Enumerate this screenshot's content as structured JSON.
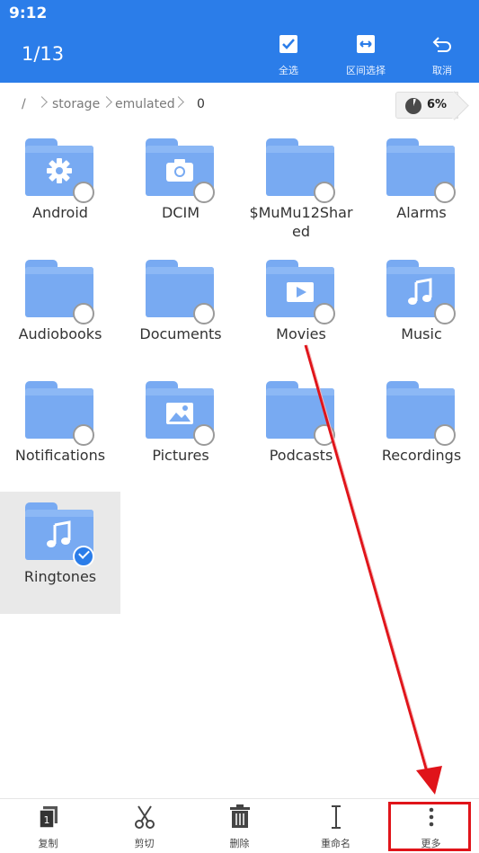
{
  "status_bar": {
    "time": "9:12"
  },
  "top_bar": {
    "counter": "1/13",
    "actions": [
      {
        "label": "全选",
        "icon": "select-all-icon"
      },
      {
        "label": "区间选择",
        "icon": "range-select-icon"
      },
      {
        "label": "取消",
        "icon": "undo-icon"
      }
    ]
  },
  "path": {
    "root": "/",
    "segments": [
      "storage",
      "emulated",
      "0"
    ],
    "storage_percent": "6%",
    "storage_used_fraction": 0.06
  },
  "folders": [
    {
      "name": "Android",
      "icon": "gear-icon",
      "selected": false
    },
    {
      "name": "DCIM",
      "icon": "camera-icon",
      "selected": false
    },
    {
      "name": "$MuMu12Shar\ned",
      "icon": "none",
      "selected": false
    },
    {
      "name": "Alarms",
      "icon": "none",
      "selected": false
    },
    {
      "name": "Audiobooks",
      "icon": "none",
      "selected": false
    },
    {
      "name": "Documents",
      "icon": "none",
      "selected": false
    },
    {
      "name": "Movies",
      "icon": "play-icon",
      "selected": false
    },
    {
      "name": "Music",
      "icon": "music-note-icon",
      "selected": false
    },
    {
      "name": "Notifications",
      "icon": "none",
      "selected": false
    },
    {
      "name": "Pictures",
      "icon": "image-icon",
      "selected": false
    },
    {
      "name": "Podcasts",
      "icon": "none",
      "selected": false
    },
    {
      "name": "Recordings",
      "icon": "none",
      "selected": false
    },
    {
      "name": "Ringtones",
      "icon": "music-note-icon",
      "selected": true
    }
  ],
  "bottom_bar": {
    "actions": [
      {
        "label": "复制",
        "icon": "copy-icon"
      },
      {
        "label": "剪切",
        "icon": "scissors-icon"
      },
      {
        "label": "删除",
        "icon": "trash-icon"
      },
      {
        "label": "重命名",
        "icon": "text-cursor-icon"
      },
      {
        "label": "更多",
        "icon": "more-vertical-icon"
      }
    ]
  },
  "colors": {
    "accent": "#2b7de9",
    "folder": "#78aaf2",
    "annotation": "#e0141a"
  }
}
